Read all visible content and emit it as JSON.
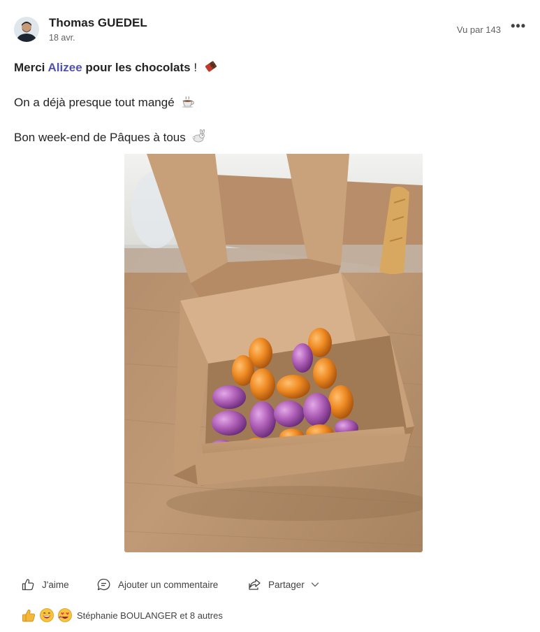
{
  "post": {
    "author": "Thomas GUEDEL",
    "date": "18 avr.",
    "views": "Vu par 143",
    "more": "•••",
    "line1": {
      "prefix": "Merci ",
      "mention": "Alizee",
      "suffix": " pour les chocolats",
      "punct": " !"
    },
    "line2": "On a déjà presque tout mangé",
    "line3": "Bon week-end de Pâques à tous"
  },
  "actions": {
    "like": "J'aime",
    "comment": "Ajouter un commentaire",
    "share": "Partager"
  },
  "reactions": {
    "icons": [
      "thumbs-up-icon",
      "grinning-face-icon",
      "heart-eyes-face-icon"
    ],
    "summary": "Stéphanie BOULANGER et 8 autres"
  },
  "colors": {
    "mention": "#4f52b2",
    "text": "#242424",
    "muted": "#616161"
  }
}
